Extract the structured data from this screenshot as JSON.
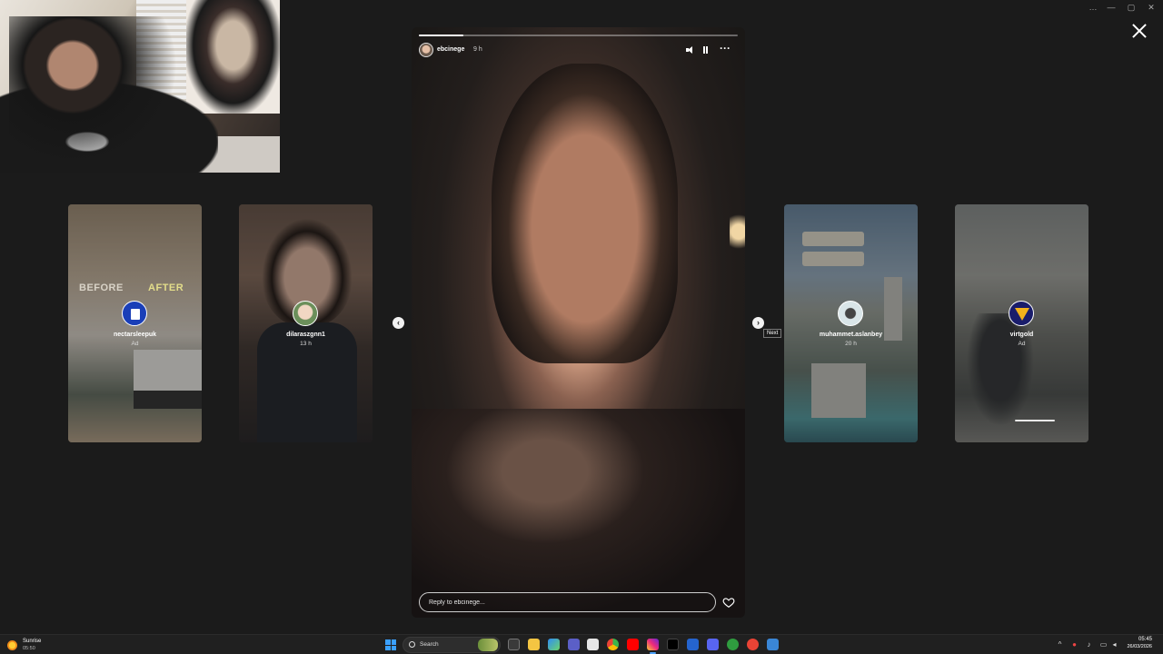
{
  "window": {
    "controls": [
      "…",
      "—",
      "▢",
      "✕"
    ]
  },
  "main_story": {
    "username": "ebcinege",
    "time_ago": "9 h",
    "progress": 0.14,
    "reply_placeholder": "Reply to ebcinege...",
    "icons": [
      "speaker-icon",
      "pause-icon",
      "more-icon",
      "heart-icon"
    ]
  },
  "side_stories": [
    {
      "username": "nectarsleepuk",
      "meta": "Ad",
      "overlay_left": "BEFORE",
      "overlay_right": "AFTER"
    },
    {
      "username": "dilaraszgnn1",
      "meta": "13 h"
    },
    {
      "username": "muhammet.aslanbey",
      "meta": "20 h"
    },
    {
      "username": "virtgold",
      "meta": "Ad"
    }
  ],
  "navigation": {
    "prev_symbol": "‹",
    "next_symbol": "›",
    "next_tooltip": "Next"
  },
  "taskbar": {
    "weather_label": "Sunrise",
    "weather_time": "05:50",
    "search_label": "Search",
    "clock_time": "05:45",
    "clock_date": "26/03/2026",
    "apps": [
      "file-explorer-icon",
      "edge-icon",
      "copilot-icon",
      "teams-icon",
      "store-icon",
      "chrome-icon",
      "youtube-icon",
      "instagram-icon",
      "tiktok-icon",
      "todo-icon",
      "discord-icon",
      "xbox-icon",
      "notepad-icon",
      "task-view-icon",
      "calculator-icon"
    ]
  },
  "colors": {
    "background": "#1b1b1b",
    "accent": "#4da3ff",
    "instagram_active": "#d6249f"
  }
}
